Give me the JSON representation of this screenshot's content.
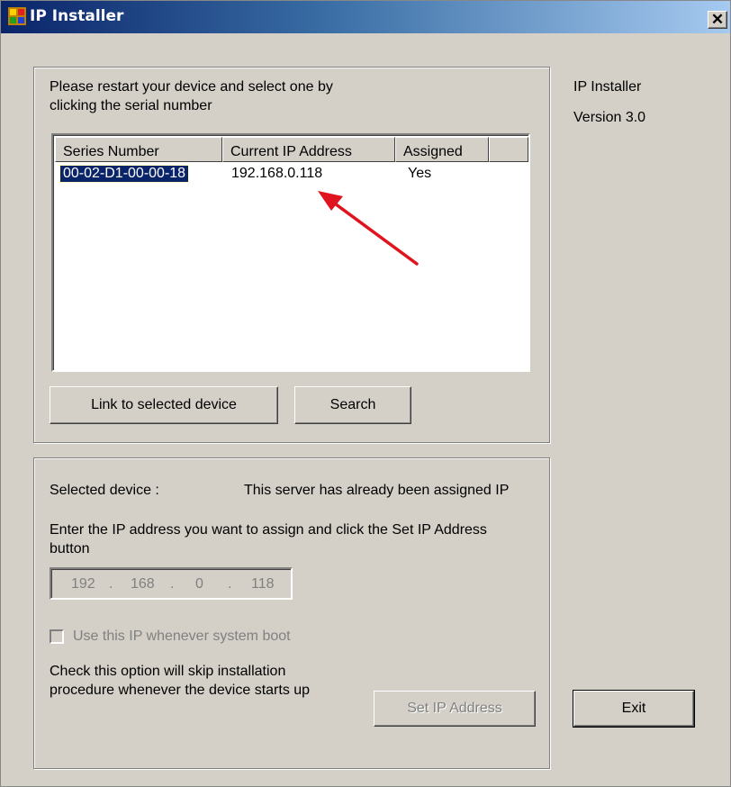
{
  "window": {
    "title": "IP Installer",
    "close_glyph": "✕"
  },
  "side_info": {
    "app_name": "IP Installer",
    "version": "Version 3.0"
  },
  "device_list": {
    "instructions_line1": "Please restart your device and select one by",
    "instructions_line2": "clicking the serial number",
    "columns": [
      "Series Number",
      "Current IP Address",
      "Assigned"
    ],
    "rows": [
      {
        "serial": "00-02-D1-00-00-18",
        "ip": "192.168.0.118",
        "assigned": "Yes"
      }
    ],
    "link_button": "Link to selected device",
    "search_button": "Search"
  },
  "assign": {
    "selected_label": "Selected device :",
    "status_text": "This server has already been assigned IP",
    "prompt_line1": "Enter the IP address you want to assign and click the Set IP Address",
    "prompt_line2": "button",
    "ip": {
      "o1": "192",
      "o2": "168",
      "o3": "0",
      "o4": "118",
      "dot": "."
    },
    "checkbox_label": "Use this IP whenever system boot",
    "note_line1": "Check this option will skip installation",
    "note_line2": "procedure whenever the device starts up",
    "set_ip_button": "Set IP Address"
  },
  "exit_button": "Exit",
  "colors": {
    "title_bar": "#0a246a",
    "selection": "#0a246a",
    "arrow": "#e0141e",
    "face": "#d4d0c8"
  }
}
